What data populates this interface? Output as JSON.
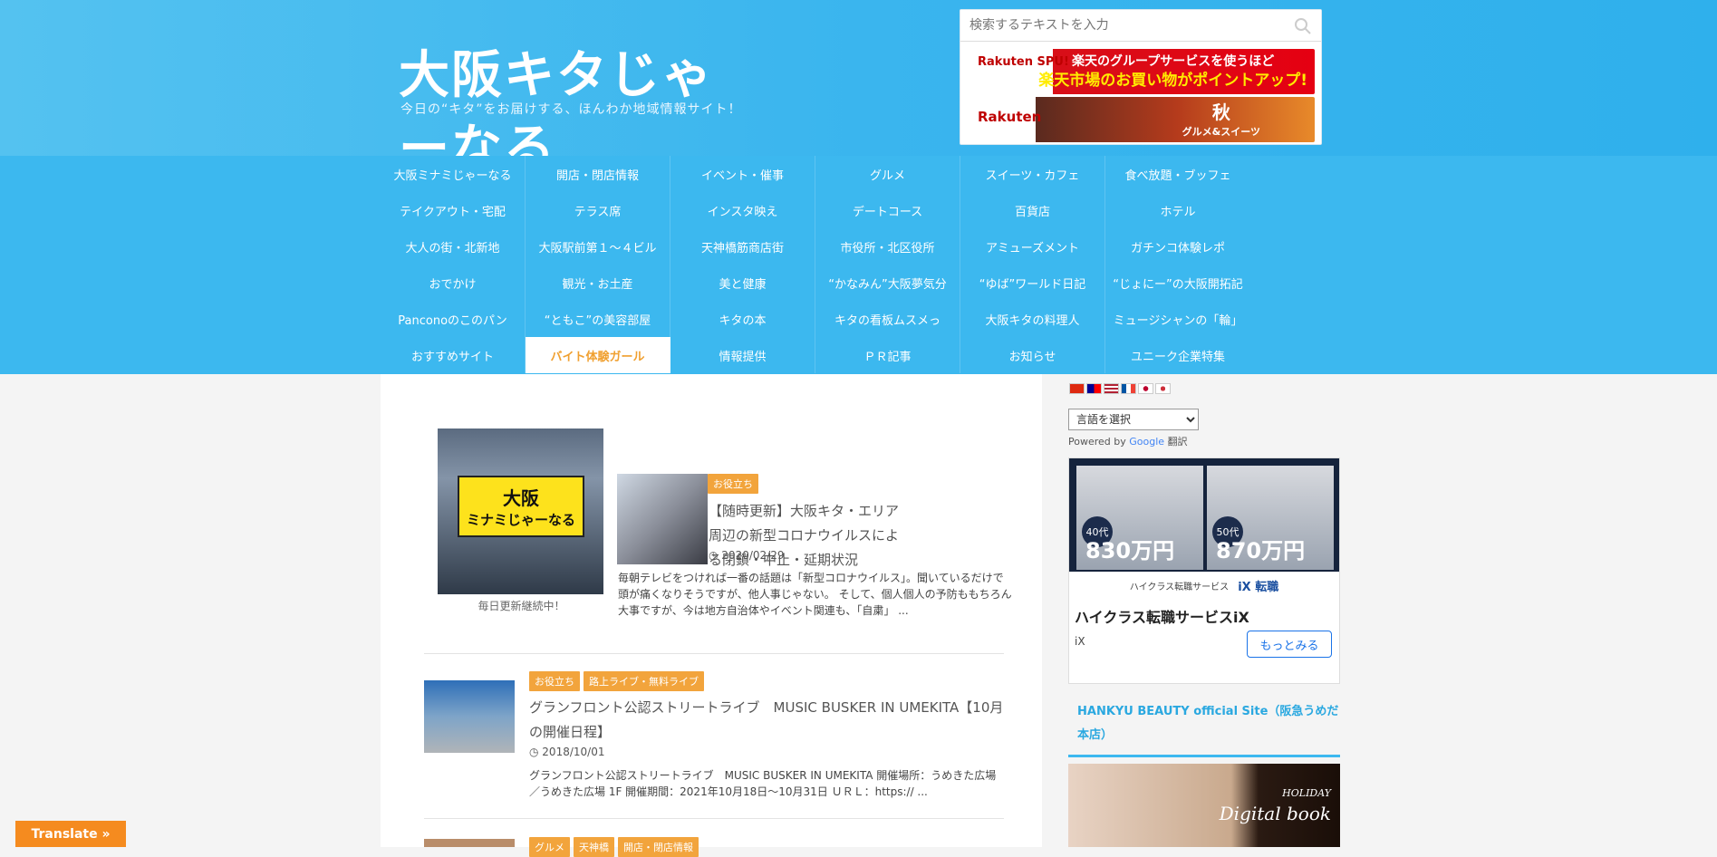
{
  "header": {
    "logo_text": "大阪キタじゃーなる",
    "tagline": "今日の“キタ”をお届けする、ほんわか地域情報サイト！",
    "search_placeholder": "検索するテキストを入力"
  },
  "banners": [
    {
      "brand": "Rakuten SPU!",
      "line1": "楽天のグループサービスを使うほど",
      "line2": "楽天市場のお買い物がポイントアップ!"
    },
    {
      "brand": "Rakuten",
      "title": "秋",
      "subtitle": "グルメ&スイーツ"
    }
  ],
  "nav": [
    "大阪ミナミじゃーなる",
    "開店・閉店情報",
    "イベント・催事",
    "グルメ",
    "スイーツ・カフェ",
    "食べ放題・ブッフェ",
    "テイクアウト・宅配",
    "テラス席",
    "インスタ映え",
    "デートコース",
    "百貨店",
    "ホテル",
    "大人の街・北新地",
    "大阪駅前第１～４ビル",
    "天神橋筋商店街",
    "市役所・北区役所",
    "アミューズメント",
    "ガチンコ体験レポ",
    "おでかけ",
    "観光・お土産",
    "美と健康",
    "“かなみん”大阪夢気分",
    "“ゆば”ワールド日記",
    "“じょにー”の大阪開拓記",
    "Panconoのこのパン",
    "“ともこ”の美容部屋",
    "キタの本",
    "キタの看板ムスメっ",
    "大阪キタの料理人",
    "ミュージシャンの「輪」",
    "おすすめサイト",
    "バイト体験ガール",
    "情報提供",
    "ＰＲ記事",
    "お知らせ",
    "ユニーク企業特集"
  ],
  "nav_active_index": 31,
  "featured": {
    "sign_line1": "大阪",
    "sign_line2": "ミナミじゃーなる",
    "caption": "毎日更新継続中！"
  },
  "posts": [
    {
      "categories": [
        "お役立ち"
      ],
      "title": "【随時更新】大阪キタ・エリア周辺の新型コロナウイルスによる閉鎖・中止・延期状況",
      "date": "2020/02/29",
      "excerpt": "毎朝テレビをつければ一番の話題は「新型コロナウイルス」。聞いているだけで頭が痛くなりそうですが、他人事じゃない。 そして、個人個人の予防ももちろん大事ですが、今は地方自治体やイベント関連も、「自粛」 ..."
    },
    {
      "categories": [
        "お役立ち",
        "路上ライブ・無料ライブ"
      ],
      "title": "グランフロント公認ストリートライブ　MUSIC BUSKER IN UMEKITA【10月の開催日程】",
      "date": "2018/10/01",
      "excerpt": "グランフロント公認ストリートライブ　MUSIC BUSKER IN UMEKITA 開催場所：うめきた広場／うめきた広場 1F 開催期間：2021年10月18日～10月31日 ＵＲＬ：https:// ..."
    },
    {
      "categories": [
        "グルメ",
        "天神橋",
        "開店・閉店情報"
      ]
    }
  ],
  "sidebar": {
    "lang_select": "言語を選択",
    "powered_by": "Powered by",
    "google": "Google",
    "translate_word": "翻訳",
    "ad": {
      "age1": "40代",
      "amount1": "830万円",
      "age2": "50代",
      "amount2": "870万円",
      "service_line": "ハイクラス転職サービス",
      "service_brand": "iX 転職",
      "title": "ハイクラス転職サービスiX",
      "source": "iX",
      "button": "もっとみる"
    },
    "hankyu_link": "HANKYU BEAUTY official Site（阪急うめだ本店）",
    "hankyu_img_text1": "HOLIDAY",
    "hankyu_img_text2": "Digital book"
  },
  "translate_button": "Translate »",
  "colors": {
    "header_bg": "#3ab5ee",
    "nav_bg": "#3cb8ef",
    "nav_active_text": "#f0a030",
    "category_tag": "#f2a43c",
    "translate_button": "#f58b1f",
    "link_blue": "#2aa8e0"
  }
}
